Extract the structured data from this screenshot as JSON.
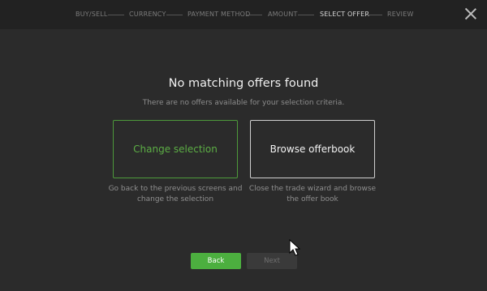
{
  "wizard": {
    "steps": [
      {
        "label": "BUY/SELL"
      },
      {
        "label": "CURRENCY"
      },
      {
        "label": "PAYMENT METHOD"
      },
      {
        "label": "AMOUNT"
      },
      {
        "label": "SELECT OFFER"
      },
      {
        "label": "REVIEW"
      }
    ],
    "active_step": "SELECT OFFER"
  },
  "main": {
    "title": "No matching offers found",
    "subtitle": "There are no offers available for your selection criteria.",
    "options": [
      {
        "label": "Change selection",
        "description": "Go back to the previous screens and change the selection"
      },
      {
        "label": "Browse offerbook",
        "description": "Close the trade wizard and browse the offer book"
      }
    ]
  },
  "footer": {
    "back_label": "Back",
    "next_label": "Next"
  },
  "colors": {
    "accent": "#4caf3f",
    "background": "#2b2b2b",
    "topbar": "#222222"
  }
}
